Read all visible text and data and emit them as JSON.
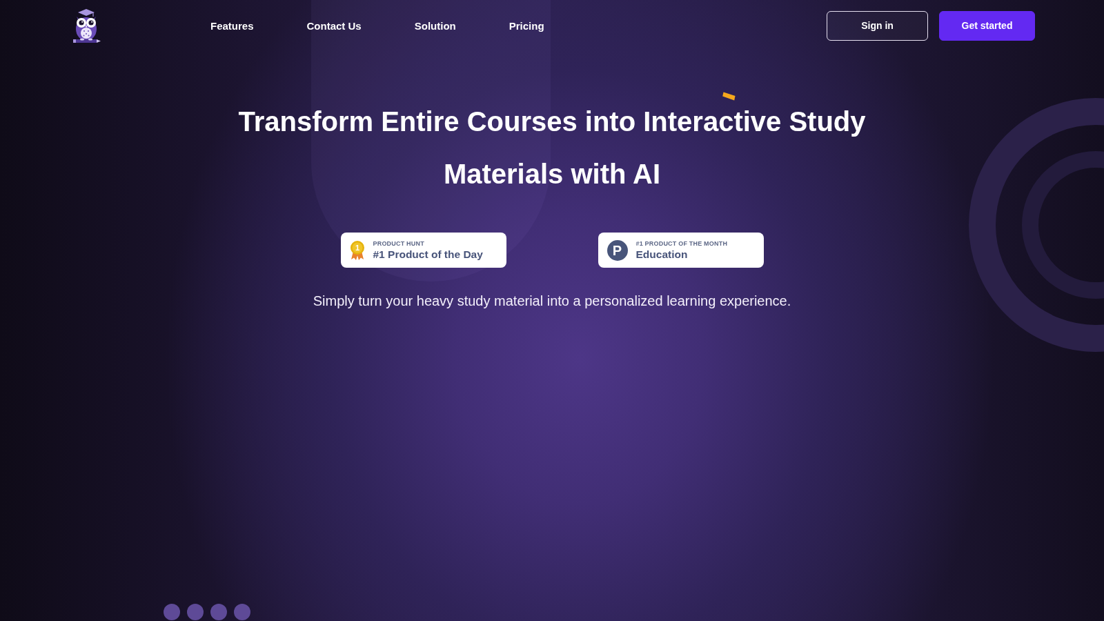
{
  "nav_links": [
    {
      "label": "Features"
    },
    {
      "label": "Contact Us"
    },
    {
      "label": "Solution"
    },
    {
      "label": "Pricing"
    }
  ],
  "actions": [
    {
      "label": "Sign in",
      "kind": "outline"
    },
    {
      "label": "Get started",
      "kind": "primary"
    }
  ],
  "hero": {
    "title": "Transform Entire Courses into Interactive Study Materials with AI",
    "badges": [
      {
        "kind": "medal",
        "icon_text": "1",
        "eyebrow": "PRODUCT HUNT",
        "text": "#1 Product of the Day"
      },
      {
        "kind": "letter_logo",
        "icon_text": "P",
        "eyebrow": "#1 PRODUCT OF THE MONTH",
        "text": "Education"
      }
    ],
    "subtitle": "Simply turn your heavy study material into a personalized learning experience."
  }
}
